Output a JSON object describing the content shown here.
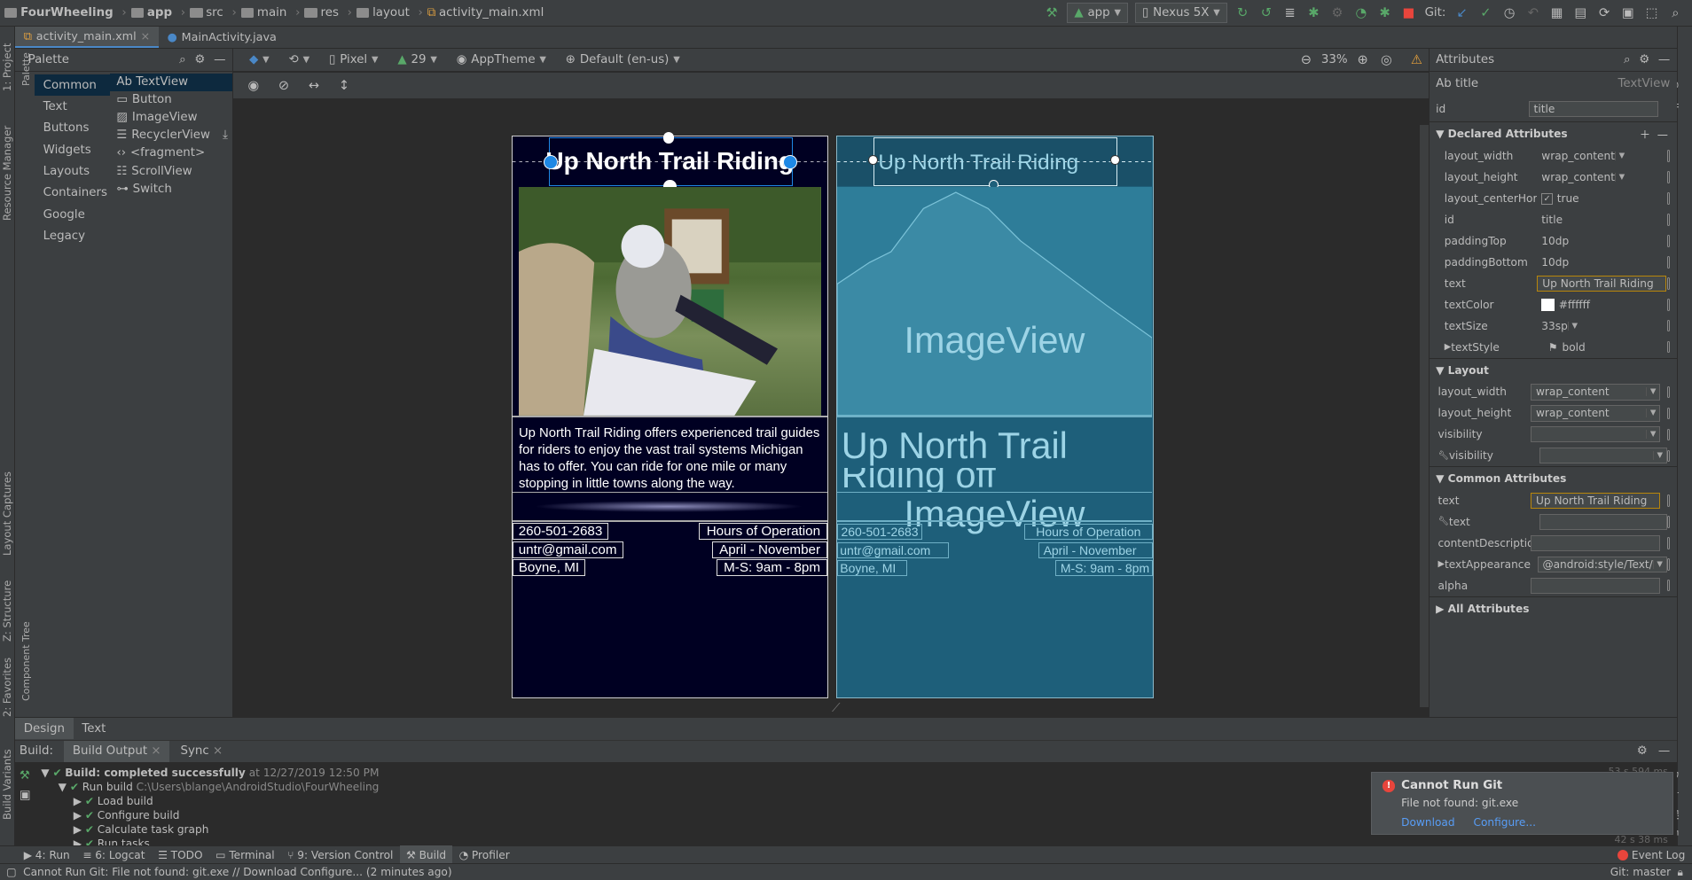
{
  "nav": {
    "crumbs": [
      "FourWheeling",
      "app",
      "src",
      "main",
      "res",
      "layout",
      "activity_main.xml"
    ],
    "run_config": "app",
    "device": "Nexus 5X",
    "git_label": "Git:"
  },
  "left_strip": [
    "1: Project",
    "Resource Manager",
    "Layout Captures",
    "Z: Structure",
    "2: Favorites",
    "Build Variants"
  ],
  "right_strip": [
    "Gradle",
    "Device File Explorer"
  ],
  "palette_side": [
    "Palette",
    "Component Tree"
  ],
  "editor_tabs": [
    {
      "label": "activity_main.xml",
      "active": true
    },
    {
      "label": "MainActivity.java",
      "active": false
    }
  ],
  "palette": {
    "title": "Palette",
    "categories": [
      "Common",
      "Text",
      "Buttons",
      "Widgets",
      "Layouts",
      "Containers",
      "Google",
      "Legacy"
    ],
    "items": [
      "Ab TextView",
      "Button",
      "ImageView",
      "RecyclerView",
      "<fragment>",
      "ScrollView",
      "Switch"
    ]
  },
  "design_toolbar": {
    "device": "Pixel",
    "api": "29",
    "theme": "AppTheme",
    "locale": "Default (en-us)",
    "zoom": "33%"
  },
  "design": {
    "title": "Up North Trail Riding",
    "description": "Up North Trail Riding offers experienced trail guides for riders to enjoy the vast trail systems Michigan has to offer.  You can ride for one mile or many stopping in little towns along the way.",
    "phone": "260-501-2683",
    "email": "untr@gmail.com",
    "location": "Boyne, MI",
    "hours_label": "Hours of Operation",
    "months": "April - November",
    "days": "M-S: 9am - 8pm"
  },
  "blueprint": {
    "title": "Up North Trail Riding",
    "imageview": "ImageView",
    "imageview2": "ImageView",
    "desc_fragment": "Up North Trail",
    "desc_fragment2": "Riding off",
    "phone": "260-501-2683",
    "email": "untr@gmail.com",
    "location": "Boyne, MI",
    "hours_label": "Hours of Operation",
    "months": "April - November",
    "days": "M-S: 9am - 8pm"
  },
  "attributes": {
    "title": "Attributes",
    "widget": "Ab title",
    "widget_type": "TextView",
    "id_label": "id",
    "id_value": "title",
    "declared_header": "Declared Attributes",
    "declared": [
      {
        "k": "layout_width",
        "v": "wrap_content",
        "dd": true
      },
      {
        "k": "layout_height",
        "v": "wrap_content",
        "dd": true
      },
      {
        "k": "layout_centerHoriz",
        "v": "true",
        "check": true
      },
      {
        "k": "id",
        "v": "title"
      },
      {
        "k": "paddingTop",
        "v": "10dp"
      },
      {
        "k": "paddingBottom",
        "v": "10dp"
      },
      {
        "k": "text",
        "v": "Up North Trail Riding",
        "hl": true
      },
      {
        "k": "textColor",
        "v": "#ffffff",
        "swatch": "#ffffff"
      },
      {
        "k": "textSize",
        "v": "33sp",
        "dd": true
      },
      {
        "k": "textStyle",
        "v": "bold",
        "expand": true
      }
    ],
    "layout_header": "Layout",
    "layout": [
      {
        "k": "layout_width",
        "v": "wrap_content"
      },
      {
        "k": "layout_height",
        "v": "wrap_content"
      },
      {
        "k": "visibility",
        "v": ""
      },
      {
        "k": "visibility",
        "v": "",
        "wrench": true
      }
    ],
    "common_header": "Common Attributes",
    "common": [
      {
        "k": "text",
        "v": "Up North Trail Riding",
        "hl": true
      },
      {
        "k": "text",
        "v": "",
        "wrench": true
      },
      {
        "k": "contentDescription",
        "v": ""
      },
      {
        "k": "textAppearance",
        "v": "@android:style/Text/",
        "expand": true,
        "dd": true
      },
      {
        "k": "alpha",
        "v": ""
      }
    ],
    "all_header": "All Attributes"
  },
  "bottom_tabs": [
    "Design",
    "Text"
  ],
  "build": {
    "label": "Build:",
    "tabs": [
      "Build Output",
      "Sync"
    ],
    "status": "Build: completed successfully",
    "status_time": "at 12/27/2019 12:50 PM",
    "run_build": "Run build",
    "run_path": "C:\\Users\\blange\\AndroidStudio\\FourWheeling",
    "tasks": [
      "Load build",
      "Configure build",
      "Calculate task graph",
      "Run tasks"
    ],
    "timing1": "53 s 594 ms",
    "timing2": "42 s 38 ms"
  },
  "notification": {
    "title": "Cannot Run Git",
    "body": "File not found: git.exe",
    "link1": "Download",
    "link2": "Configure..."
  },
  "toolwindows": [
    "4: Run",
    "6: Logcat",
    "TODO",
    "Terminal",
    "9: Version Control",
    "Build",
    "Profiler"
  ],
  "event_log": "Event Log",
  "status": {
    "message": "Cannot Run Git: File not found: git.exe // Download Configure... (2 minutes ago)",
    "branch": "Git: master"
  },
  "colors": {
    "accent": "#4a88c7",
    "success": "#59a869",
    "error": "#e8453c",
    "phone_bg": "#000022",
    "blueprint_bg": "#1e5f7a"
  }
}
